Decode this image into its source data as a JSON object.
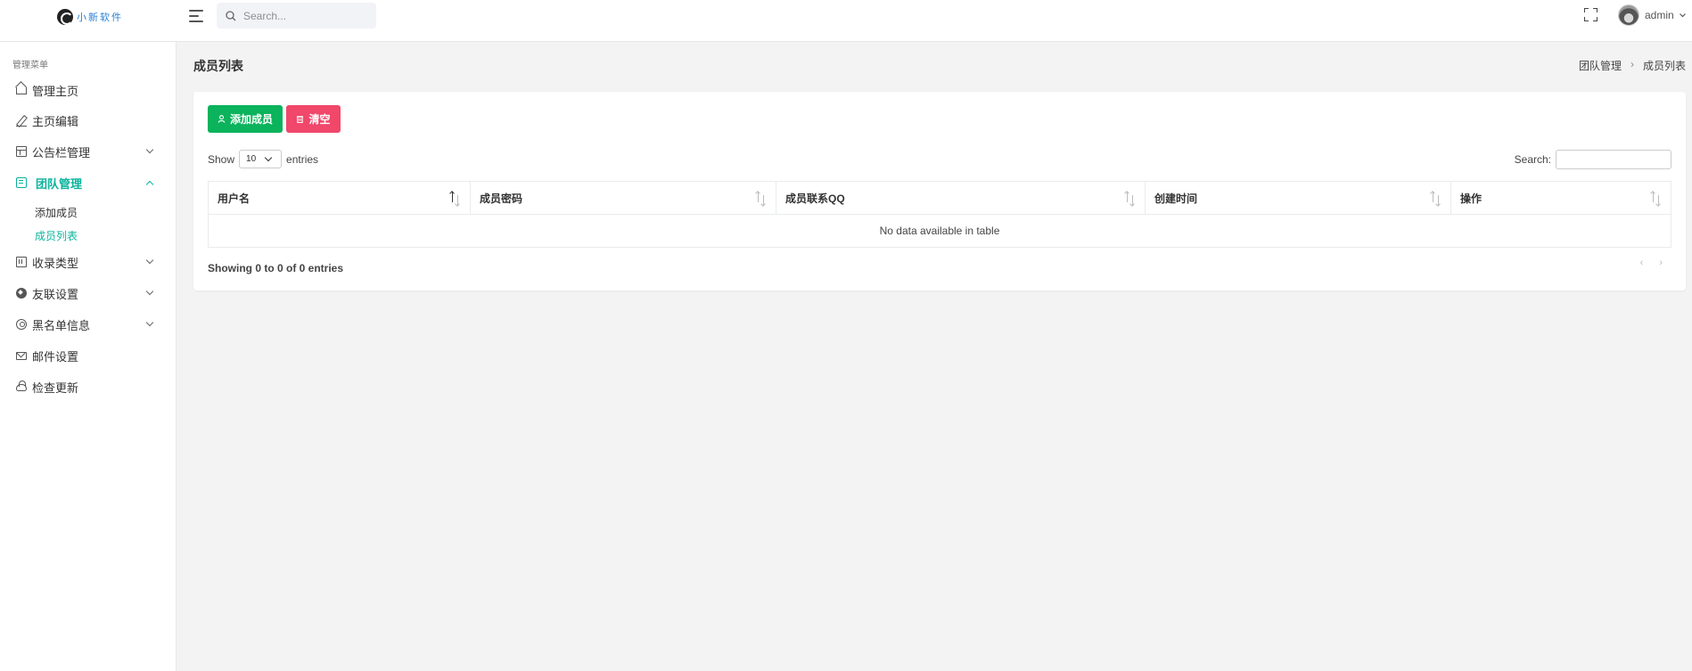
{
  "header": {
    "logo_text": "小新软件",
    "search_placeholder": "Search...",
    "user_name": "admin"
  },
  "sidebar": {
    "menu_title": "管理菜单",
    "items": [
      {
        "label": "管理主页",
        "icon": "home-icon"
      },
      {
        "label": "主页编辑",
        "icon": "pen-icon"
      },
      {
        "label": "公告栏管理",
        "icon": "board-icon"
      },
      {
        "label": "团队管理",
        "icon": "team-icon"
      },
      {
        "label": "收录类型",
        "icon": "calculator-icon"
      },
      {
        "label": "友联设置",
        "icon": "compass-icon"
      },
      {
        "label": "黑名单信息",
        "icon": "user-circle-icon"
      },
      {
        "label": "邮件设置",
        "icon": "mail-icon"
      },
      {
        "label": "检查更新",
        "icon": "cloud-icon"
      }
    ],
    "team_subitems": [
      "添加成员",
      "成员列表"
    ],
    "active_color": "#0ab39c"
  },
  "page": {
    "title": "成员列表",
    "breadcrumb": [
      "团队管理",
      "成员列表"
    ]
  },
  "toolbar": {
    "add_label": "添加成员",
    "clear_label": "清空"
  },
  "table": {
    "show_label": "Show",
    "entries_value": "10",
    "entries_label": "entries",
    "search_label": "Search:",
    "columns": [
      "用户名",
      "成员密码",
      "成员联系QQ",
      "创建时间",
      "操作"
    ],
    "empty_text": "No data available in table",
    "info": "Showing 0 to 0 of 0 entries",
    "prev": "‹",
    "next": "›"
  }
}
